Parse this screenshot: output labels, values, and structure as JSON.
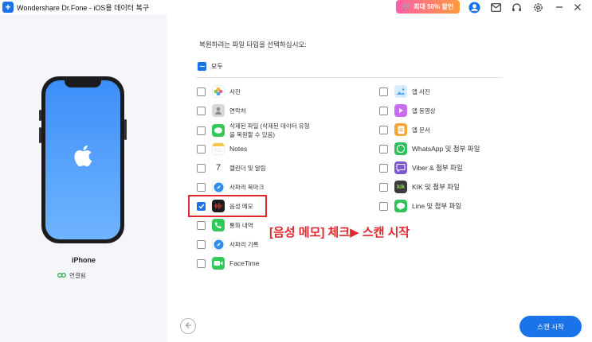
{
  "titlebar": {
    "title": "Wondershare Dr.Fone - iOS용 데이터 복구",
    "promo_label": "최대 50% 할인",
    "icons": [
      "account-icon",
      "mail-icon",
      "headset-icon",
      "settings-icon",
      "minimize-icon",
      "close-icon"
    ]
  },
  "device": {
    "name": "iPhone",
    "status": "연결됨"
  },
  "main": {
    "heading": "복원하려는 파일 타입을 선택하십시오:",
    "select_all_label": "모두",
    "left_items": [
      {
        "label": "사진",
        "icon": "photos-icon",
        "checked": false
      },
      {
        "label": "연락처",
        "icon": "contacts-icon",
        "checked": false
      },
      {
        "label": "삭제된 파일 (삭제된 데이터 유형",
        "label2": "을 복원할 수 있음)",
        "icon": "messages-icon",
        "checked": false
      },
      {
        "label": "Notes",
        "icon": "notes-icon",
        "checked": false
      },
      {
        "label": "캘린더 및 알림",
        "icon": "calendar-icon",
        "checked": false
      },
      {
        "label": "사파리 북마크",
        "icon": "safari-icon",
        "checked": false
      },
      {
        "label": "음성 메모",
        "icon": "voice-memo-icon",
        "checked": true
      },
      {
        "label": "통화 내역",
        "icon": "phone-icon",
        "checked": false
      },
      {
        "label": "사파리 기록",
        "icon": "safari-history-icon",
        "checked": false
      },
      {
        "label": "FaceTime",
        "icon": "facetime-icon",
        "checked": false
      }
    ],
    "right_items": [
      {
        "label": "앱 사진",
        "icon": "app-photos-icon",
        "checked": false
      },
      {
        "label": "앱 동영상",
        "icon": "app-videos-icon",
        "checked": false
      },
      {
        "label": "앱 문서",
        "icon": "app-documents-icon",
        "checked": false
      },
      {
        "label": "WhatsApp 및 첨부 파일",
        "icon": "whatsapp-icon",
        "checked": false
      },
      {
        "label": "Viber & 첨부 파일",
        "icon": "viber-icon",
        "checked": false
      },
      {
        "label": "KIK 및 첨부 파일",
        "icon": "kik-icon",
        "checked": false
      },
      {
        "label": "Line 및 첨부 파일",
        "icon": "line-icon",
        "checked": false
      }
    ],
    "annotation": "[음성 메모] 체크▶ 스캔 시작",
    "scan_button": "스캔 시작"
  },
  "colors": {
    "accent": "#1a73e8",
    "annotation": "#e0282e",
    "panel_bg": "#f4f6f9"
  }
}
